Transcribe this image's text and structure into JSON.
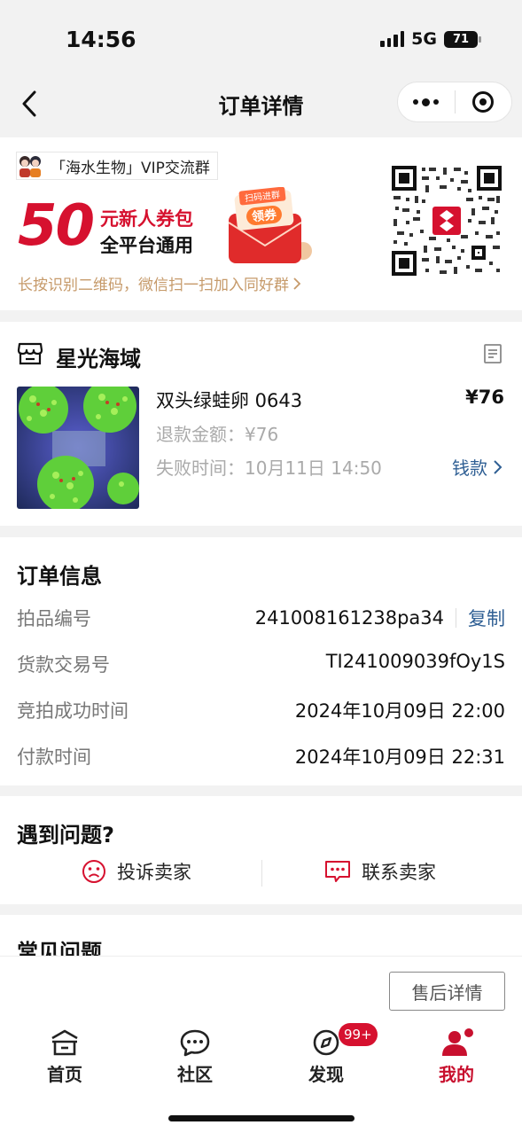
{
  "status_bar": {
    "time": "14:56",
    "network": "5G",
    "battery": "71"
  },
  "nav": {
    "title": "订单详情"
  },
  "promo": {
    "group_name": "「海水生物」VIP交流群",
    "amount": "50",
    "line1": "元新人券包",
    "line2": "全平台通用",
    "envelope_top": "扫码进群",
    "envelope_main": "领券",
    "hint": "长按识别二维码，微信扫一扫加入同好群"
  },
  "shop": {
    "name": "星光海域",
    "product_title": "双头绿蛙卵 0643",
    "price": "¥76",
    "refund_label": "退款金额：",
    "refund_value": "¥76",
    "fail_label": "失败时间：",
    "fail_value": "10月11日 14:50",
    "refund_link": "钱款"
  },
  "order_info": {
    "title": "订单信息",
    "rows": [
      {
        "label": "拍品编号",
        "value": "241008161238pa34"
      },
      {
        "label": "货款交易号",
        "value": "TI241009039fOy1S"
      },
      {
        "label": "竞拍成功时间",
        "value": "2024年10月09日 22:00"
      },
      {
        "label": "付款时间",
        "value": "2024年10月09日 22:31"
      }
    ],
    "copy_label": "复制"
  },
  "problems": {
    "title": "遇到问题?",
    "complain": "投诉卖家",
    "contact": "联系卖家"
  },
  "faq": {
    "title": "常见问题"
  },
  "actions": {
    "after_sale": "售后详情"
  },
  "tabbar": {
    "items": [
      {
        "label": "首页"
      },
      {
        "label": "社区"
      },
      {
        "label": "发现"
      },
      {
        "label": "我的"
      }
    ],
    "badge": "99+"
  },
  "colors": {
    "accent": "#d6112f",
    "link": "#2f5f94",
    "hint": "#c69a6a"
  }
}
